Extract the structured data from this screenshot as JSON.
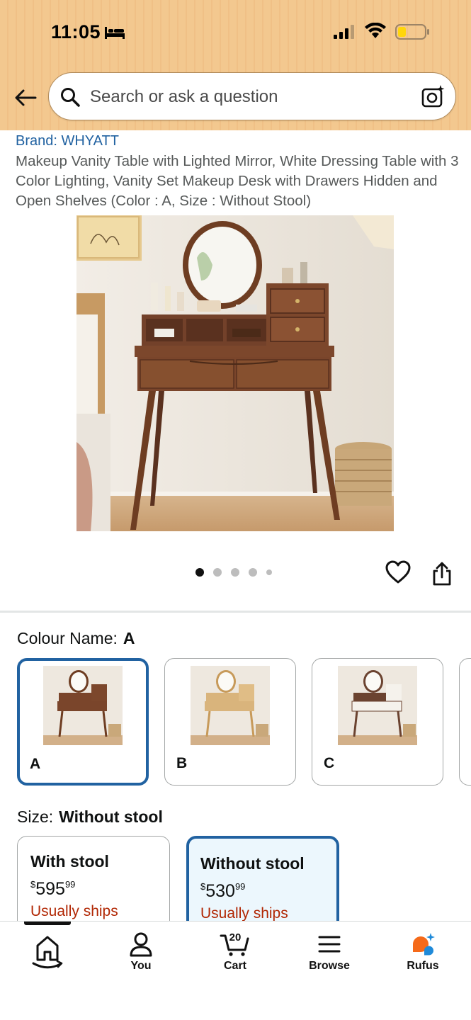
{
  "status_bar": {
    "time": "11:05"
  },
  "search": {
    "placeholder": "Search or ask a question"
  },
  "product": {
    "brand": "Brand: WHYATT",
    "title": "Makeup Vanity Table with Lighted Mirror, White Dressing Table with 3 Color Lighting, Vanity Set Makeup Desk with Drawers Hidden and Open Shelves (Color : A, Size : Without Stool)",
    "image_count": 5,
    "image_index": 1
  },
  "colour": {
    "label": "Colour Name:",
    "selected": "A",
    "options": [
      {
        "label": "A",
        "tone": "#7a4a2c"
      },
      {
        "label": "B",
        "tone": "#d9b47c"
      },
      {
        "label": "C",
        "tone": "#6b4330"
      }
    ]
  },
  "size": {
    "label": "Size:",
    "selected": "Without stool",
    "options": [
      {
        "name": "With stool",
        "currency": "$",
        "price_whole": "595",
        "price_fraction": "99",
        "shipping": "Usually ships"
      },
      {
        "name": "Without stool",
        "currency": "$",
        "price_whole": "530",
        "price_fraction": "99",
        "shipping": "Usually ships"
      }
    ]
  },
  "nav": {
    "items": [
      {
        "label": "",
        "icon": "home-icon"
      },
      {
        "label": "You",
        "icon": "user-icon"
      },
      {
        "label": "Cart",
        "icon": "cart-icon",
        "count": "20"
      },
      {
        "label": "Browse",
        "icon": "menu-icon"
      },
      {
        "label": "Rufus",
        "icon": "rufus-icon"
      }
    ]
  },
  "colors": {
    "header_bg": "#f3c88f",
    "link": "#2162a1",
    "selected_border": "#2162a1",
    "ship_text": "#b12704",
    "rufus_orange": "#f56a1a",
    "rufus_blue": "#1f8ad9"
  }
}
